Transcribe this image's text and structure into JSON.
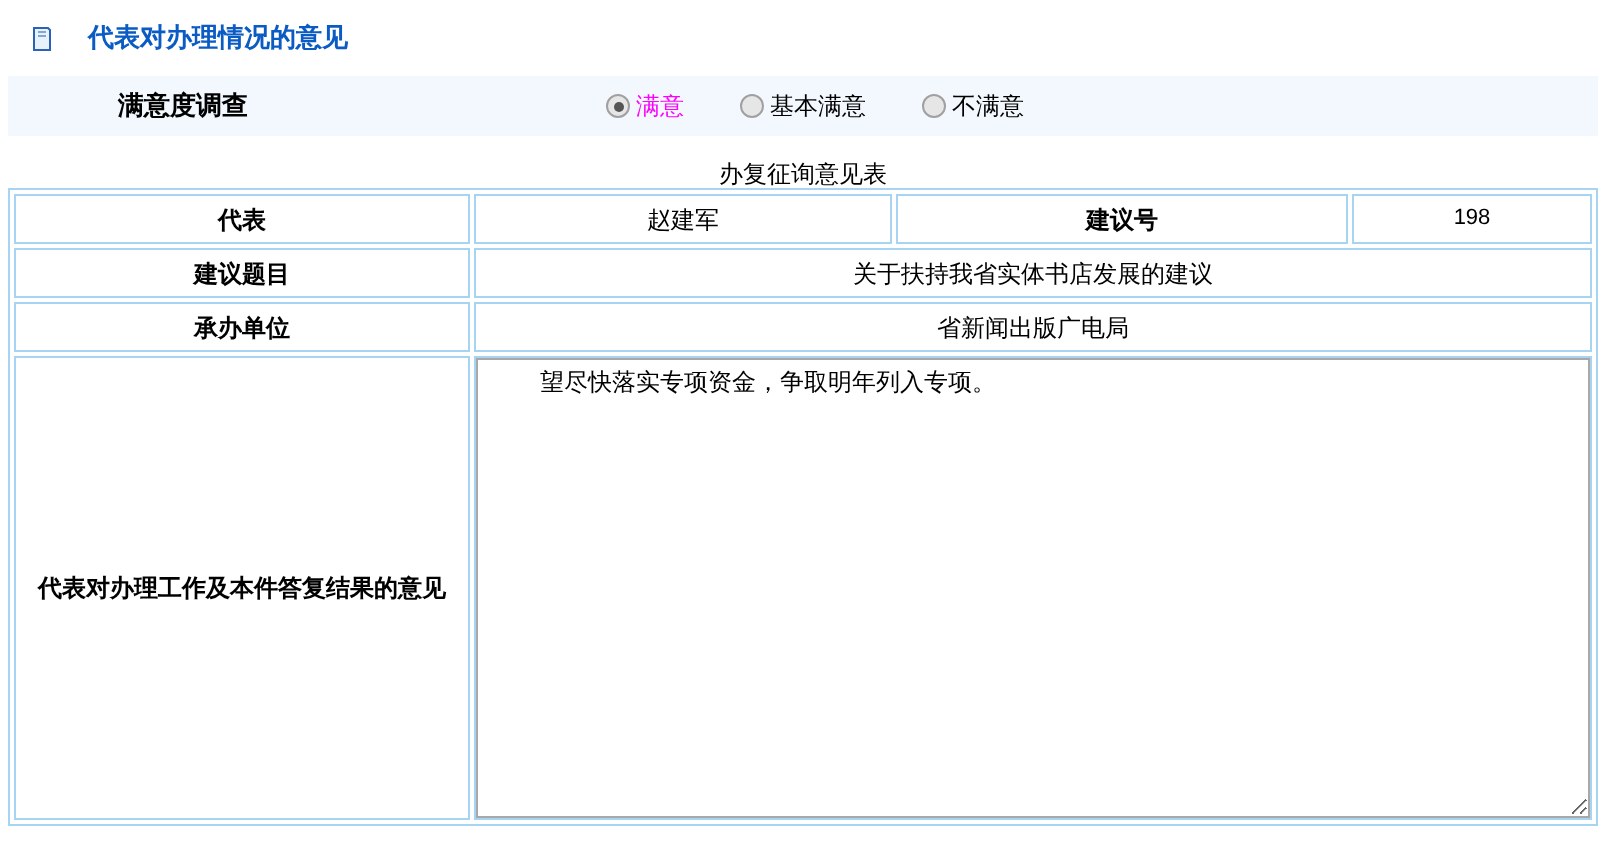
{
  "section_title": "代表对办理情况的意见",
  "survey": {
    "label": "满意度调查",
    "options": [
      {
        "label": "满意",
        "selected": true
      },
      {
        "label": "基本满意",
        "selected": false
      },
      {
        "label": "不满意",
        "selected": false
      }
    ]
  },
  "form": {
    "caption": "办复征询意见表",
    "representative_label": "代表",
    "representative": "赵建军",
    "proposal_no_label": "建议号",
    "proposal_no": "198",
    "topic_label": "建议题目",
    "topic": "关于扶持我省实体书店发展的建议",
    "unit_label": "承办单位",
    "unit": "省新闻出版广电局",
    "opinion_label": "代表对办理工作及本件答复结果的意见",
    "opinion": "望尽快落实专项资金，争取明年列入专项。"
  }
}
